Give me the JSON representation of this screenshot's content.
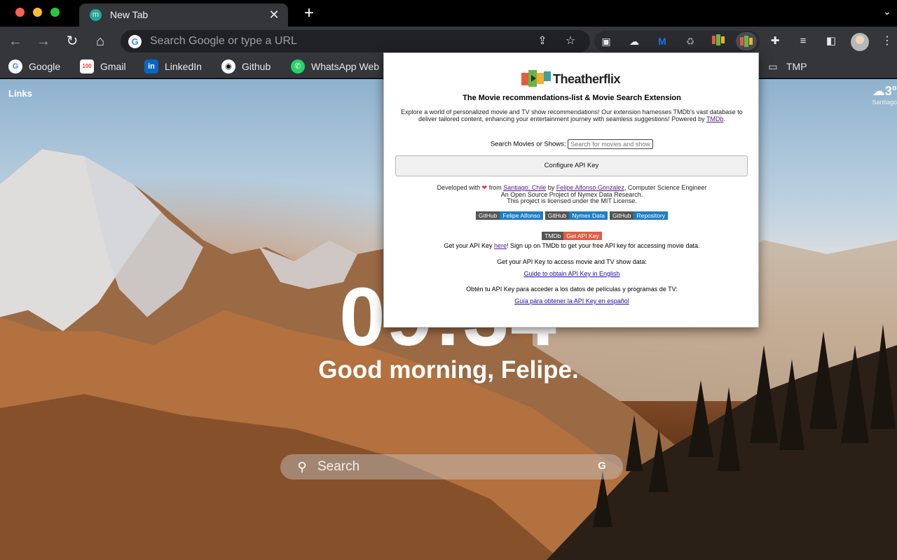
{
  "browser": {
    "tab": {
      "title": "New Tab",
      "favicon_letter": "m",
      "close_icon": "✕"
    },
    "new_tab_icon": "+",
    "tab_search_icon": "⌄",
    "omnibox": {
      "placeholder": "Search Google or type a URL",
      "g_letter": "G"
    },
    "bookmarks": [
      {
        "label": "Google",
        "icon": "G",
        "color": "#4285f4"
      },
      {
        "label": "Gmail",
        "icon": "100",
        "color": "#ea4335"
      },
      {
        "label": "LinkedIn",
        "icon": "in",
        "color": "#0a66c2"
      },
      {
        "label": "Github",
        "icon": "◉",
        "color": "#ffffff"
      },
      {
        "label": "WhatsApp Web",
        "icon": "✆",
        "color": "#25d366"
      },
      {
        "label": "TMP",
        "icon": "📁",
        "color": "#e8eaed"
      }
    ]
  },
  "ntp": {
    "links_label": "Links",
    "weather": {
      "temp": "3°",
      "city": "Santiago",
      "icon": "☁"
    },
    "clock": "09:34",
    "greeting": "Good morning, Felipe.",
    "search_placeholder": "Search",
    "search_g": "G"
  },
  "popup": {
    "logo_text": "Theatherflix",
    "title": "The Movie recommendations-list & Movie Search Extension",
    "description": "Explore a world of personalized movie and TV show recommendations! Our extension harnesses TMDb's vast database to deliver tailored content, enhancing your entertainment journey with seamless suggestions! Powered by",
    "description_link": "TMDb",
    "search_label": "Search Movies or Shows:",
    "search_placeholder": "Search for movies and shows",
    "configure_button": "Configure API Key",
    "credits_developed": "Developed with",
    "credits_from": "from",
    "credits_city": "Santiago, Chile",
    "credits_by": "by",
    "credits_author": "Felipe Alfonso Gonzalez",
    "credits_role": ", Computer Science Engineer",
    "credits_line2": "An Open Source Project of Nymex Data Research.",
    "credits_line3": "This project is licensed under the MIT License.",
    "badges": [
      {
        "left": "GitHub",
        "right": "Felipe Alfonso"
      },
      {
        "left": "GitHub",
        "right": "Nymex Data"
      },
      {
        "left": "GitHub",
        "right": "Repository"
      }
    ],
    "tmdb_badge": {
      "left": "TMDb",
      "right": "Get API Key"
    },
    "api_pre": "Get your API Key",
    "api_link": "here",
    "api_post": "! Sign up on TMDb to get your free API key for accessing movie data.",
    "access_en": "Get your API Key to access movie and TV show data:",
    "guide_en": "Guide to obtain API Key in English",
    "access_es": "Obtén tu API Key para acceder a los datos de películas y programas de TV:",
    "guide_es": "Guía para obtener la API Key en español"
  },
  "colors": {
    "tab_active": "#35363a",
    "omnibox_bg": "#202124",
    "link_purple": "#551a8b",
    "badge_blue": "#1f7ec2",
    "badge_orange": "#e05d44"
  }
}
